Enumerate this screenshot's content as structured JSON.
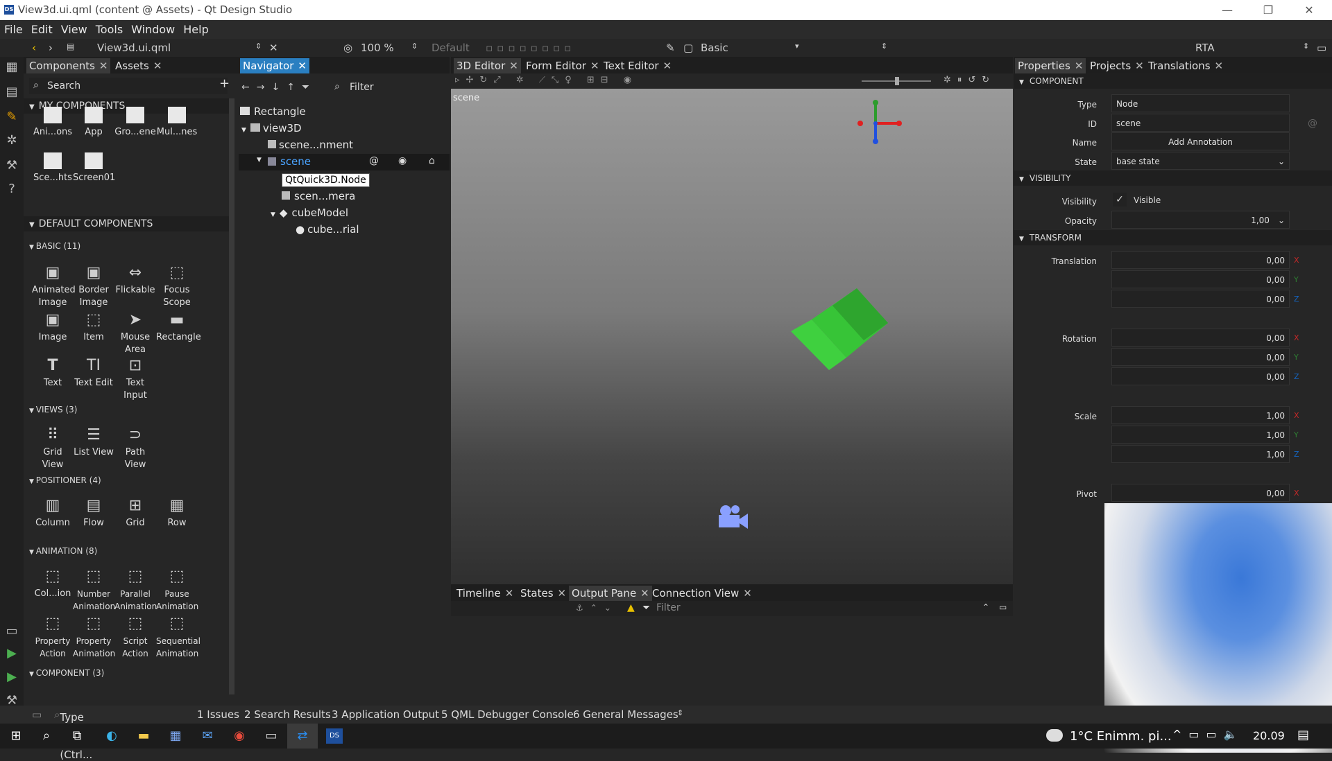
{
  "window": {
    "title": "View3d.ui.qml (content @ Assets) - Qt Design Studio",
    "logo": "DS",
    "min": "—",
    "max": "❐",
    "close": "✕"
  },
  "menu": [
    "File",
    "Edit",
    "View",
    "Tools",
    "Window",
    "Help"
  ],
  "toolbar": {
    "file": "View3d.ui.qml",
    "zoom": "100 %",
    "state_default": "Default",
    "style": "Basic",
    "rta": "RTA"
  },
  "components_tabs": [
    "Components",
    "Assets"
  ],
  "navigator_tabs": [
    "Navigator"
  ],
  "editor_tabs": [
    "3D Editor",
    "Form Editor",
    "Text Editor"
  ],
  "props_tabs": [
    "Properties",
    "Projects",
    "Translations"
  ],
  "search": {
    "placeholder": "Search",
    "add": "+"
  },
  "sections": {
    "my": "MY COMPONENTS",
    "default": "DEFAULT COMPONENTS",
    "basic": "BASIC (11)",
    "views": "VIEWS (3)",
    "positioner": "POSITIONER (4)",
    "animation": "ANIMATION (8)",
    "component": "COMPONENT (3)"
  },
  "my_components": [
    "Ani...ons",
    "App",
    "Gro...ene",
    "Mul...nes",
    "Sce...hts",
    "Screen01"
  ],
  "basic": [
    "Animated Image",
    "Border Image",
    "Flickable",
    "Focus Scope",
    "Image",
    "Item",
    "Mouse Area",
    "Rectangle",
    "Text",
    "Text Edit",
    "Text Input"
  ],
  "views": [
    "Grid View",
    "List View",
    "Path View"
  ],
  "positioner": [
    "Column",
    "Flow",
    "Grid",
    "Row"
  ],
  "animation": [
    "Col...ion",
    "Number Animation",
    "Parallel Animation",
    "Pause Animation",
    "Property Action",
    "Property Animation",
    "Script Action",
    "Sequential Animation"
  ],
  "navigator": {
    "filter": "Filter",
    "tree": [
      "Rectangle",
      "view3D",
      "scene...nment",
      "scene",
      "scen...mera",
      "cubeModel",
      "cube...rial"
    ],
    "tooltip": "QtQuick3D.Node",
    "at": "@"
  },
  "viewport": {
    "label": "scene"
  },
  "bottom_tabs": [
    "Timeline",
    "States",
    "Output Pane",
    "Connection View"
  ],
  "output": {
    "filter": "Filter"
  },
  "properties": {
    "sec_component": "COMPONENT",
    "sec_visibility": "VISIBILITY",
    "sec_transform": "TRANSFORM",
    "type_label": "Type",
    "type_value": "Node",
    "id_label": "ID",
    "id_value": "scene",
    "name_label": "Name",
    "name_value": "Add Annotation",
    "state_label": "State",
    "state_value": "base state",
    "visibility_label": "Visibility",
    "visible_text": "Visible",
    "opacity_label": "Opacity",
    "opacity_value": "1,00",
    "translation_label": "Translation",
    "translation": [
      "0,00",
      "0,00",
      "0,00"
    ],
    "rotation_label": "Rotation",
    "rotation": [
      "0,00",
      "0,00",
      "0,00"
    ],
    "scale_label": "Scale",
    "scale": [
      "1,00",
      "1,00",
      "1,00"
    ],
    "pivot_label": "Pivot",
    "pivot_x": "0,00",
    "axes": [
      "X",
      "Y",
      "Z"
    ]
  },
  "statusbar": {
    "locate": "Type to locate (Ctrl...",
    "items": [
      "1  Issues",
      "2  Search Results",
      "3  Application Output",
      "5  QML Debugger Console",
      "6  General Messages"
    ]
  },
  "taskbar": {
    "weather": "1°C  Enimm. pi...",
    "time": "20.09"
  }
}
